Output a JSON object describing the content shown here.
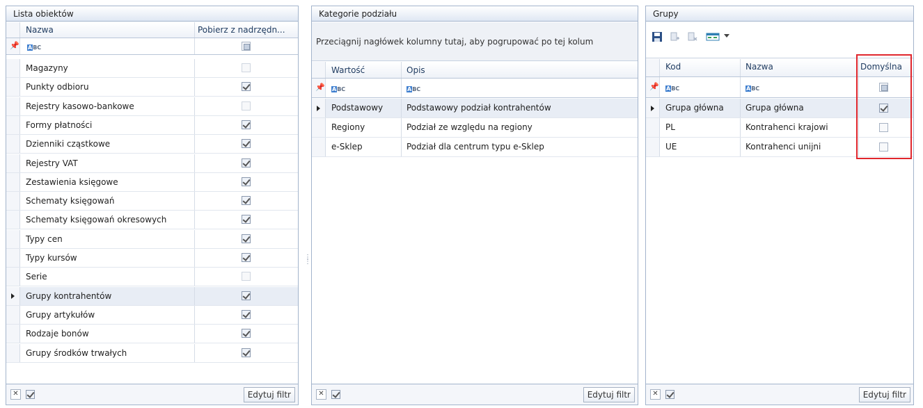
{
  "panels": {
    "lista": {
      "title": "Lista obiektów",
      "col_name": "Nazwa",
      "col_inherit": "Pobierz z nadrzędn...",
      "rows": [
        {
          "name": "Magazyny",
          "checked": false,
          "disabled": true
        },
        {
          "name": "Punkty odbioru",
          "checked": true
        },
        {
          "name": "Rejestry kasowo-bankowe",
          "checked": false,
          "disabled": true
        },
        {
          "name": "Formy płatności",
          "checked": true
        },
        {
          "name": "Dzienniki cząstkowe",
          "checked": true
        },
        {
          "name": "Rejestry VAT",
          "checked": true
        },
        {
          "name": "Zestawienia księgowe",
          "checked": true
        },
        {
          "name": "Schematy księgowań",
          "checked": true
        },
        {
          "name": "Schematy księgowań okresowych",
          "checked": true
        },
        {
          "name": "Typy cen",
          "checked": true
        },
        {
          "name": "Typy kursów",
          "checked": true
        },
        {
          "name": "Serie",
          "checked": false,
          "disabled": true
        },
        {
          "name": "Grupy kontrahentów",
          "checked": true,
          "selected": true
        },
        {
          "name": "Grupy artykułów",
          "checked": true
        },
        {
          "name": "Rodzaje bonów",
          "checked": true
        },
        {
          "name": "Grupy środków trwałych",
          "checked": true
        }
      ],
      "filter_button": "Edytuj filtr"
    },
    "kategorie": {
      "title": "Kategorie podziału",
      "group_hint": "Przeciągnij nagłówek kolumny tutaj, aby pogrupować po tej kolum",
      "col_value": "Wartość",
      "col_desc": "Opis",
      "rows": [
        {
          "value": "Podstawowy",
          "desc": "Podstawowy podział kontrahentów",
          "selected": true
        },
        {
          "value": "Regiony",
          "desc": "Podział ze względu na regiony"
        },
        {
          "value": "e-Sklep",
          "desc": "Podział dla centrum typu e-Sklep"
        }
      ],
      "filter_button": "Edytuj filtr"
    },
    "grupy": {
      "title": "Grupy",
      "col_code": "Kod",
      "col_name": "Nazwa",
      "col_default": "Domyślna",
      "rows": [
        {
          "code": "Grupa główna",
          "name": "Grupa główna",
          "checked": true,
          "selected": true
        },
        {
          "code": "PL",
          "name": "Kontrahenci krajowi",
          "checked": false
        },
        {
          "code": "UE",
          "name": "Kontrahenci unijni",
          "checked": false
        }
      ],
      "filter_button": "Edytuj filtr"
    }
  },
  "colors": {
    "highlight": "#e0262c",
    "border": "#a3b4cc"
  }
}
